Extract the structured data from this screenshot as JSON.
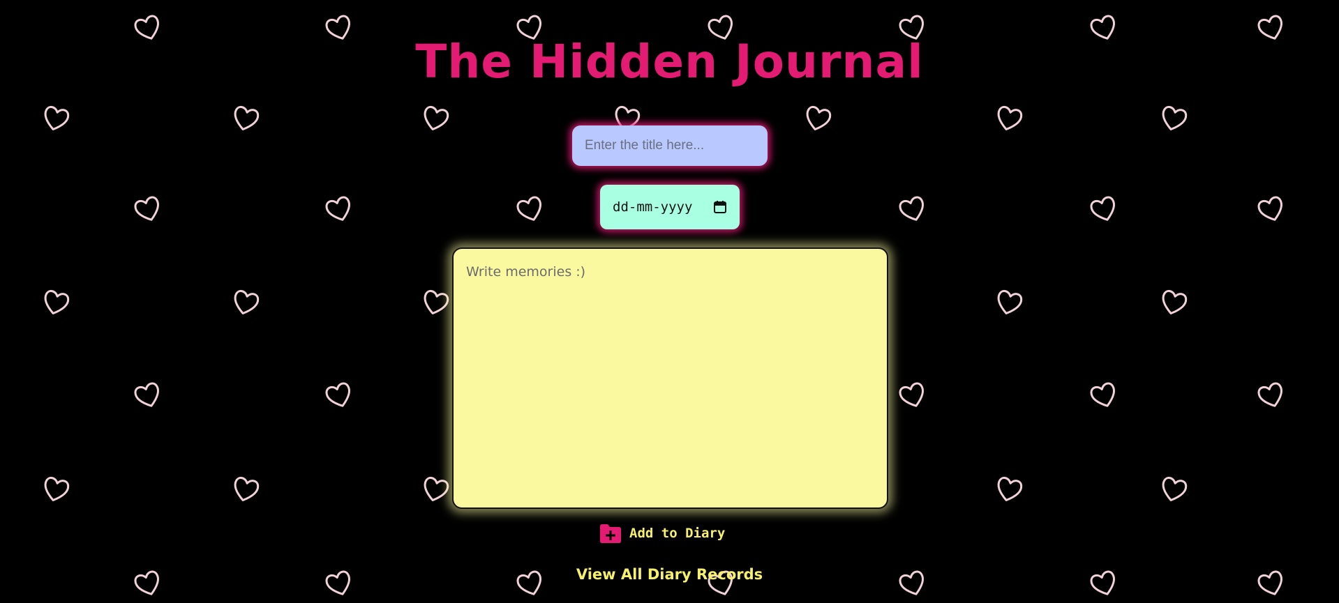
{
  "header": {
    "title": "The Hidden Journal"
  },
  "form": {
    "title_placeholder": "Enter the title here...",
    "title_value": "",
    "date_display": "dd-mm-yyyy",
    "date_icon": "calendar-icon",
    "memory_placeholder": "Write memories :)",
    "memory_value": ""
  },
  "actions": {
    "add_label": "Add to Diary",
    "add_icon": "folder-plus-icon",
    "view_all_label": "View All Diary Records"
  },
  "background": {
    "pattern_icon": "heart-outline-icon"
  },
  "colors": {
    "background": "#000000",
    "title": "#e31b73",
    "title_input_bg": "#b9c9ff",
    "date_bg": "#a9ffe2",
    "memory_bg": "#faf9a0",
    "action_text": "#f6f06a",
    "glow": "#e31b73",
    "heart_stroke": "#f0d2d8"
  }
}
